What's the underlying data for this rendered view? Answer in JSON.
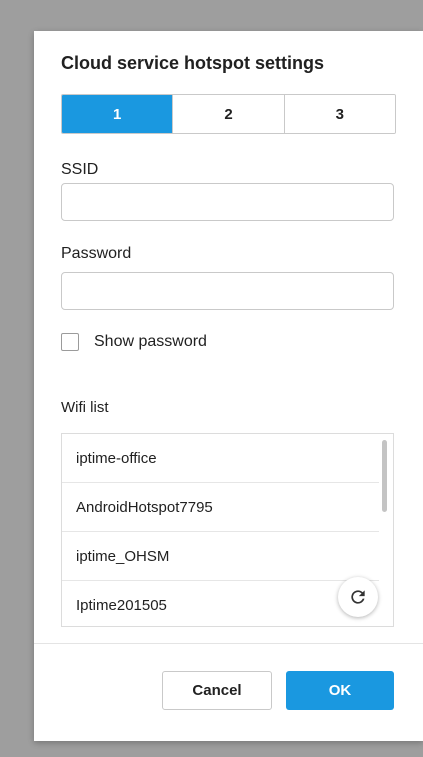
{
  "dialog": {
    "title": "Cloud service hotspot settings",
    "tabs": [
      "1",
      "2",
      "3"
    ],
    "selected_tab": "1",
    "ssid_label": "SSID",
    "ssid_value": "",
    "password_label": "Password",
    "password_value": "",
    "show_password_label": "Show password",
    "show_password_checked": false,
    "wifi_list_label": "Wifi list",
    "wifi_list": [
      "iptime-office",
      "AndroidHotspot7795",
      "iptime_OHSM",
      "Iptime201505"
    ],
    "refresh_icon": "refresh-icon",
    "cancel_label": "Cancel",
    "ok_label": "OK"
  },
  "colors": {
    "accent": "#1a98e0",
    "backdrop": "#9e9e9e"
  }
}
